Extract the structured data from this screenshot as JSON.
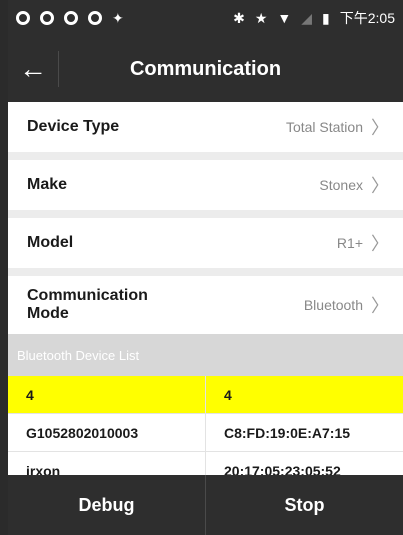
{
  "status": {
    "left_icons": [
      "app-icon",
      "app-icon",
      "sync-icon",
      "app-icon",
      "android-icon"
    ],
    "time": "下午2:05",
    "right_icons": [
      "bluetooth-icon",
      "star-icon",
      "wifi-icon",
      "signal-icon",
      "battery-icon"
    ]
  },
  "header": {
    "title": "Communication",
    "back_icon": "back-arrow-icon"
  },
  "settings": [
    {
      "label": "Device Type",
      "value": "Total Station"
    },
    {
      "label": "Make",
      "value": "Stonex"
    },
    {
      "label": "Model",
      "value": "R1+"
    },
    {
      "label": "Communication Mode",
      "value": "Bluetooth"
    }
  ],
  "bluetooth_list": {
    "title": "Bluetooth Device List",
    "columns": [
      "4",
      "4"
    ],
    "rows": [
      [
        "G1052802010003",
        "C8:FD:19:0E:A7:15"
      ],
      [
        "irxon",
        "20:17:05:23:05:52"
      ]
    ]
  },
  "footer": {
    "debug_label": "Debug",
    "stop_label": "Stop"
  },
  "colors": {
    "bar": "#2e2e2e",
    "highlight": "#ffff00",
    "background": "#ececec"
  }
}
